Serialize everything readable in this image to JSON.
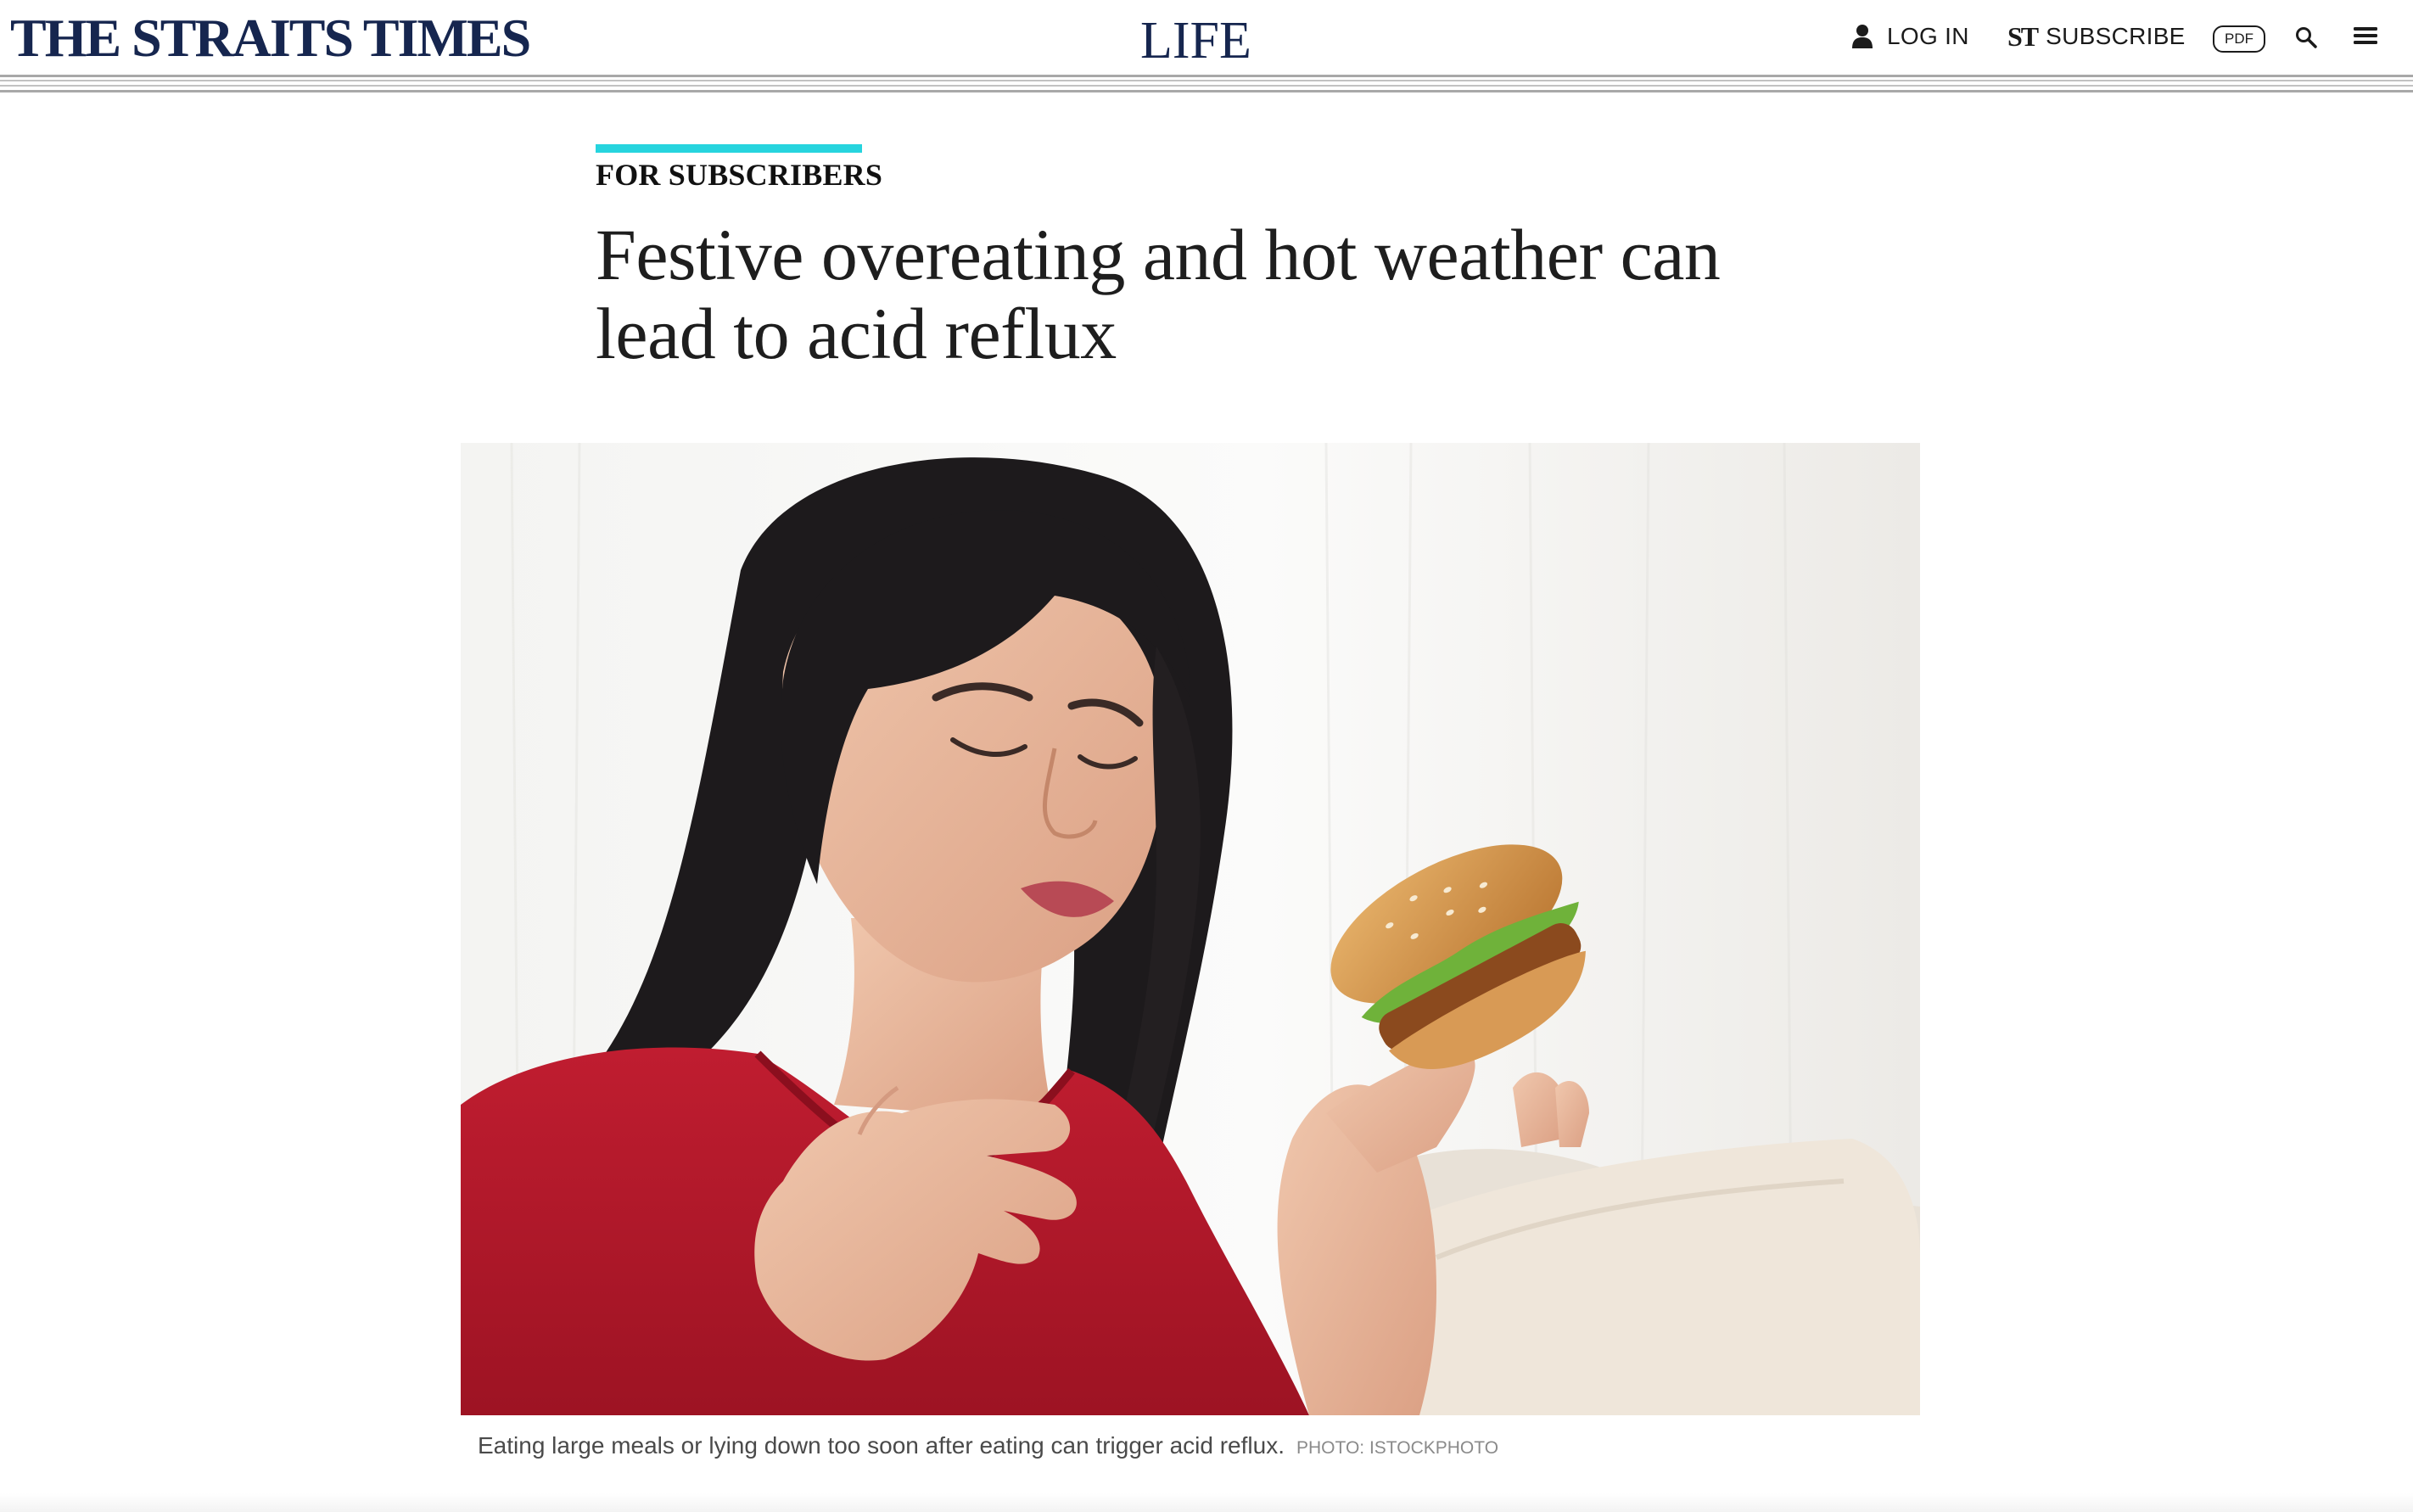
{
  "header": {
    "brand": "THE STRAITS TIMES",
    "section": "LIFE",
    "login_label": "LOG IN",
    "subscribe_label": "SUBSCRIBE",
    "subscribe_mark": "ST",
    "pdf_label": "PDF",
    "icons": {
      "login": "user-icon",
      "search": "search-icon",
      "menu": "hamburger-menu-icon"
    }
  },
  "article": {
    "flag": "FOR SUBSCRIBERS",
    "flag_color": "#26d4de",
    "headline": "Festive overeating and hot weather can lead to acid reflux",
    "image": {
      "caption": "Eating large meals or lying down too soon after eating can trigger acid reflux.",
      "credit": "PHOTO: ISTOCKPHOTO"
    }
  },
  "colors": {
    "brand_navy": "#16264f",
    "text": "#1e1e1e",
    "accent": "#26d4de",
    "shirt_red": "#b5182a"
  }
}
